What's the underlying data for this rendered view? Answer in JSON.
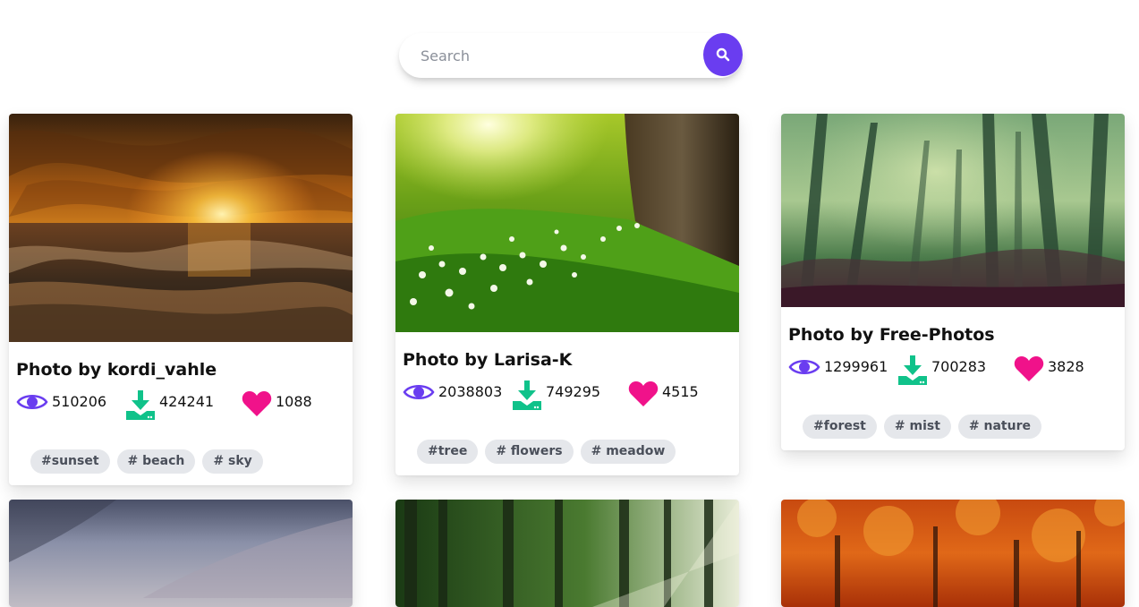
{
  "search": {
    "placeholder": "Search",
    "value": ""
  },
  "icons": {
    "views": "eye-icon",
    "downloads": "download-icon",
    "likes": "heart-icon",
    "search": "search-icon"
  },
  "colors": {
    "accent": "#6a3df0",
    "views": "#6a3df0",
    "downloads": "#10c28a",
    "likes": "#f0128a"
  },
  "cards": [
    {
      "title": "Photo by kordi_vahle",
      "views": "510206",
      "downloads": "424241",
      "likes": "1088",
      "tags": [
        "#sunset",
        "# beach",
        "# sky"
      ]
    },
    {
      "title": "Photo by Larisa-K",
      "views": "2038803",
      "downloads": "749295",
      "likes": "4515",
      "tags": [
        "#tree",
        "# flowers",
        "# meadow"
      ]
    },
    {
      "title": "Photo by Free-Photos",
      "views": "1299961",
      "downloads": "700283",
      "likes": "3828",
      "tags": [
        "#forest",
        "# mist",
        "# nature"
      ]
    }
  ]
}
